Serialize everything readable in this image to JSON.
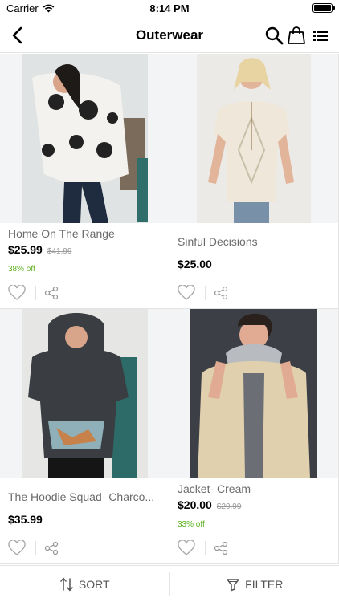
{
  "status_bar": {
    "carrier": "Carrier",
    "time": "8:14 PM"
  },
  "nav": {
    "title": "Outerwear"
  },
  "products": [
    {
      "name": "Home On The Range",
      "price": "$25.99",
      "old_price": "$41.99",
      "discount": "38% off"
    },
    {
      "name": "Sinful Decisions",
      "price": "$25.00",
      "old_price": "",
      "discount": ""
    },
    {
      "name": "The Hoodie Squad- Charco...",
      "price": "$35.99",
      "old_price": "",
      "discount": ""
    },
    {
      "name": "Jacket- Cream",
      "price": "$20.00",
      "old_price": "$29.99",
      "discount": "33% off"
    }
  ],
  "bottom_bar": {
    "sort_label": "SORT",
    "filter_label": "FILTER"
  },
  "colors": {
    "discount": "#5bb01f",
    "divider": "#e3e3e3",
    "muted_text": "#6b6b6b"
  }
}
